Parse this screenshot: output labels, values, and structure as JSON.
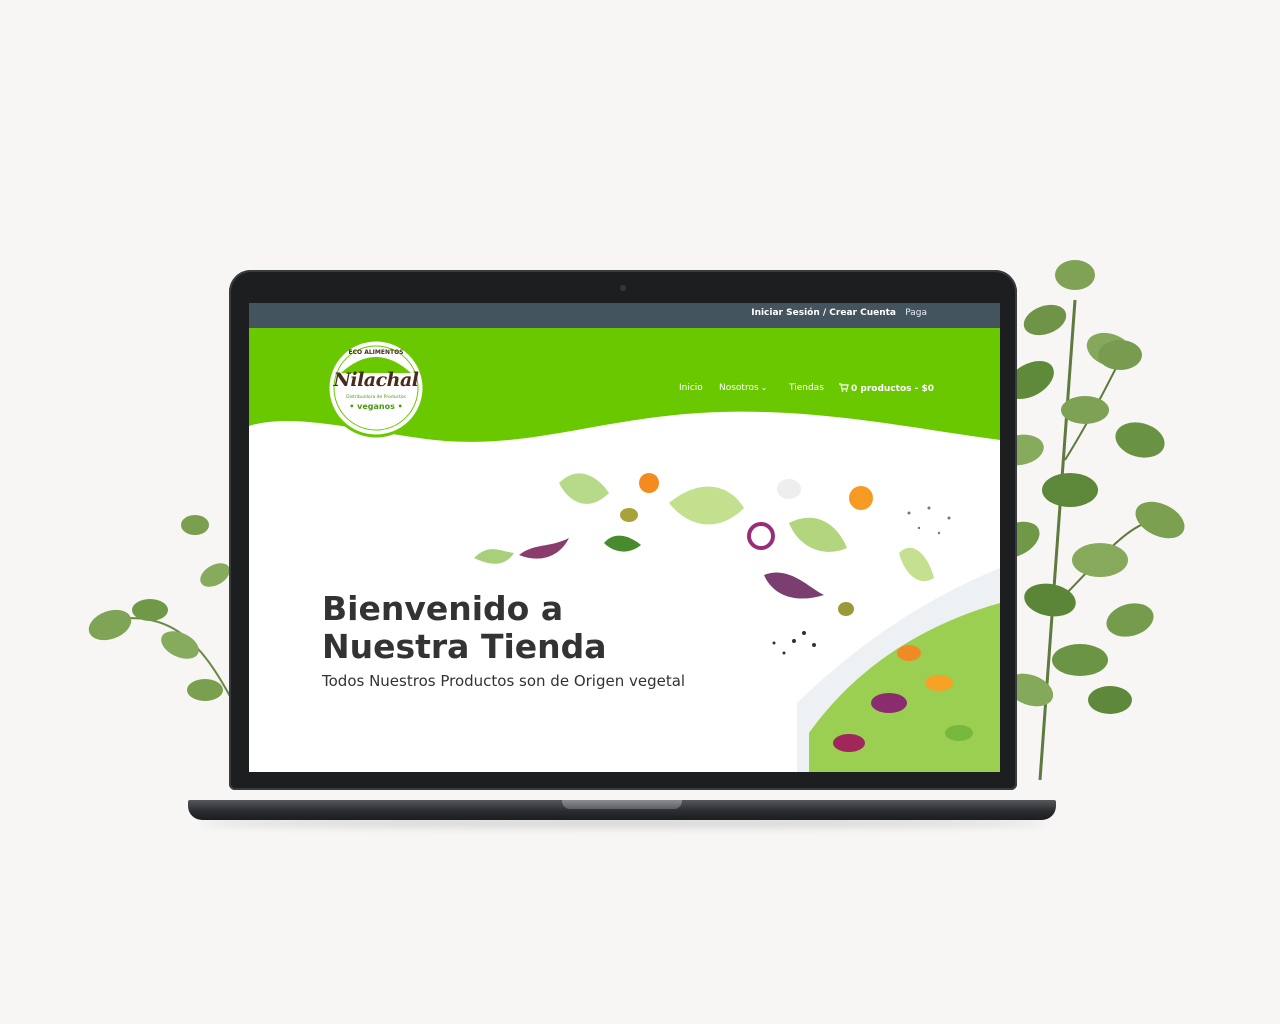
{
  "topbar": {
    "login_label": "Iniciar Sesión / Crear Cuenta",
    "extra_label": "Paga"
  },
  "logo": {
    "top_text": "ECO ALIMENTOS",
    "name": "Nilachal",
    "subtitle": "Distribuidora de Productos",
    "bottom_text": "• veganos •"
  },
  "nav": {
    "items": [
      {
        "label": "Inicio"
      },
      {
        "label": "Nosotros"
      },
      {
        "label": "Tiendas"
      }
    ],
    "cart_label": "0 productos - $0"
  },
  "hero": {
    "title_line1": "Bienvenido a",
    "title_line2": "Nuestra Tienda",
    "subtitle": "Todos Nuestros Productos son de Origen vegetal"
  },
  "colors": {
    "header_green": "#6ac800",
    "topbar_slate": "#43545e",
    "heading_text": "#333333",
    "logo_brown": "#4a2a1b"
  },
  "icons": [
    "cart-icon",
    "chevron-down-icon",
    "camera-icon"
  ]
}
